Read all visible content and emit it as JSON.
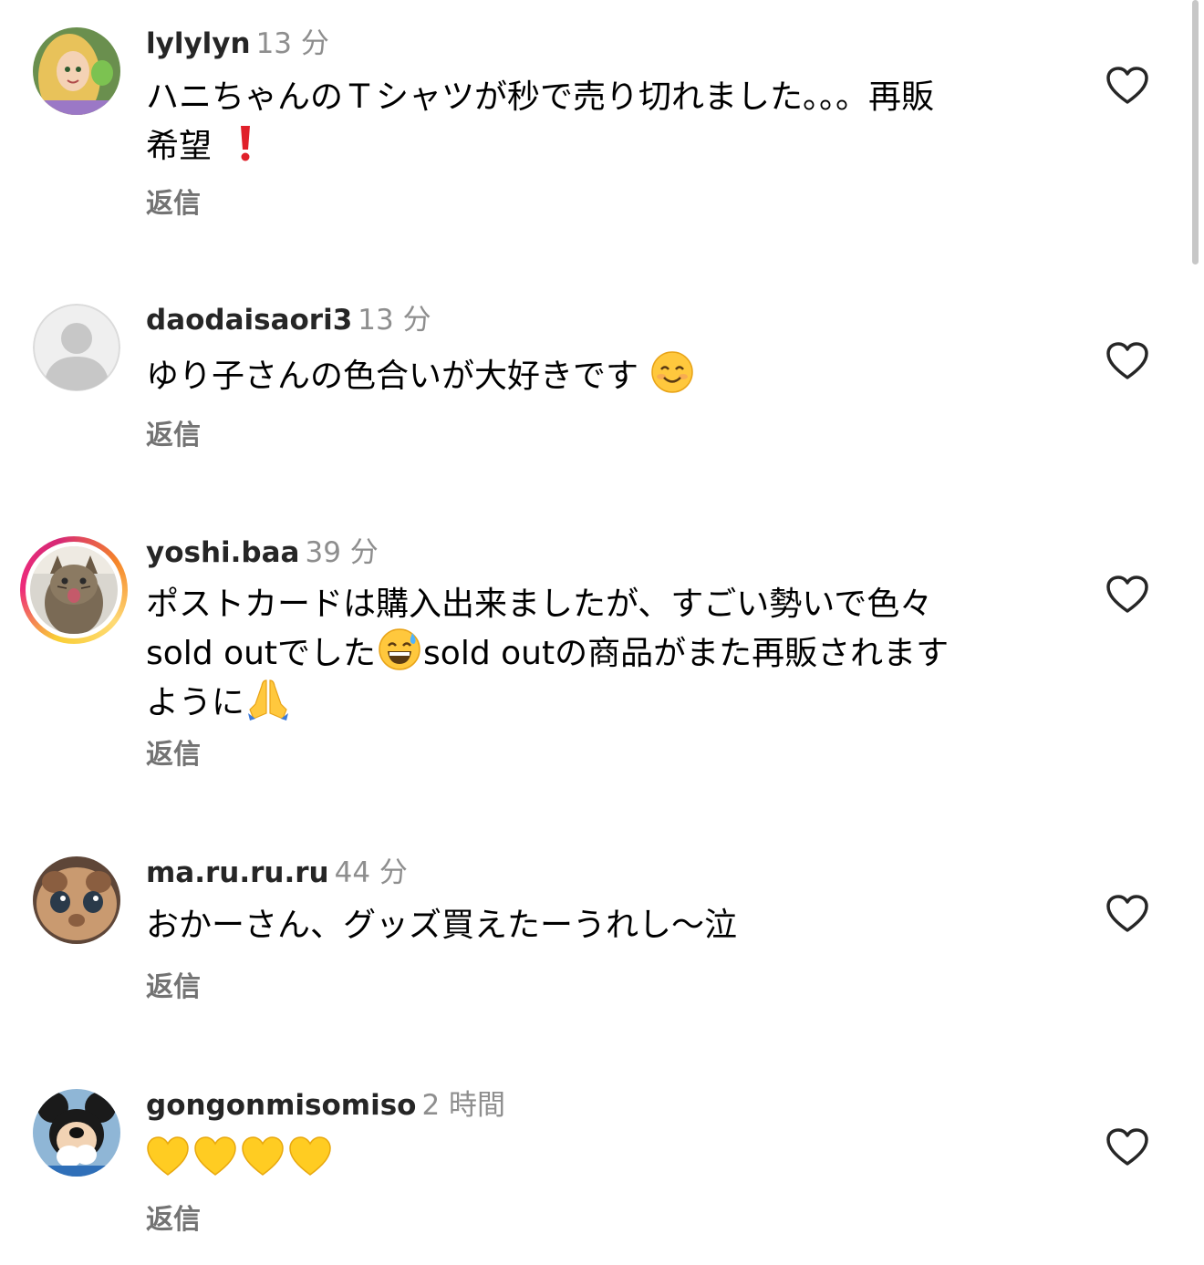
{
  "comments": [
    {
      "username": "lylylyn",
      "time": "13 分",
      "text_line1": "ハニちゃんのＴシャツが秒で売り切れました。。。再販",
      "text_line2": "希望",
      "reply": "返信"
    },
    {
      "username": "daodaisaori3",
      "time": "13 分",
      "text": "ゆり子さんの色合いが大好きです",
      "reply": "返信"
    },
    {
      "username": "yoshi.baa",
      "time": "39 分",
      "text_line1": "ポストカードは購入出来ましたが、すごい勢いで色々",
      "text_line2a": "sold outでした",
      "text_line2b": "sold outの商品がまた再販されます",
      "text_line3": "ように",
      "reply": "返信"
    },
    {
      "username": "ma.ru.ru.ru",
      "time": "44 分",
      "text": "おかーさん、グッズ買えたーうれし〜泣",
      "reply": "返信"
    },
    {
      "username": "gongonmisomiso",
      "time": "2 時間",
      "reply": "返信"
    }
  ],
  "icons": {
    "like": "heart-outline-icon",
    "exclamation": "red-exclamation-emoji",
    "smile": "smiling-face-emoji",
    "sweat": "grinning-sweat-emoji",
    "pray": "folded-hands-emoji",
    "heart": "yellow-heart-emoji"
  },
  "colors": {
    "username": "#262626",
    "time": "#8e8e8e",
    "reply": "#737373",
    "story_ring_start": "#f9ce34",
    "story_ring_end": "#ee2a7b"
  }
}
